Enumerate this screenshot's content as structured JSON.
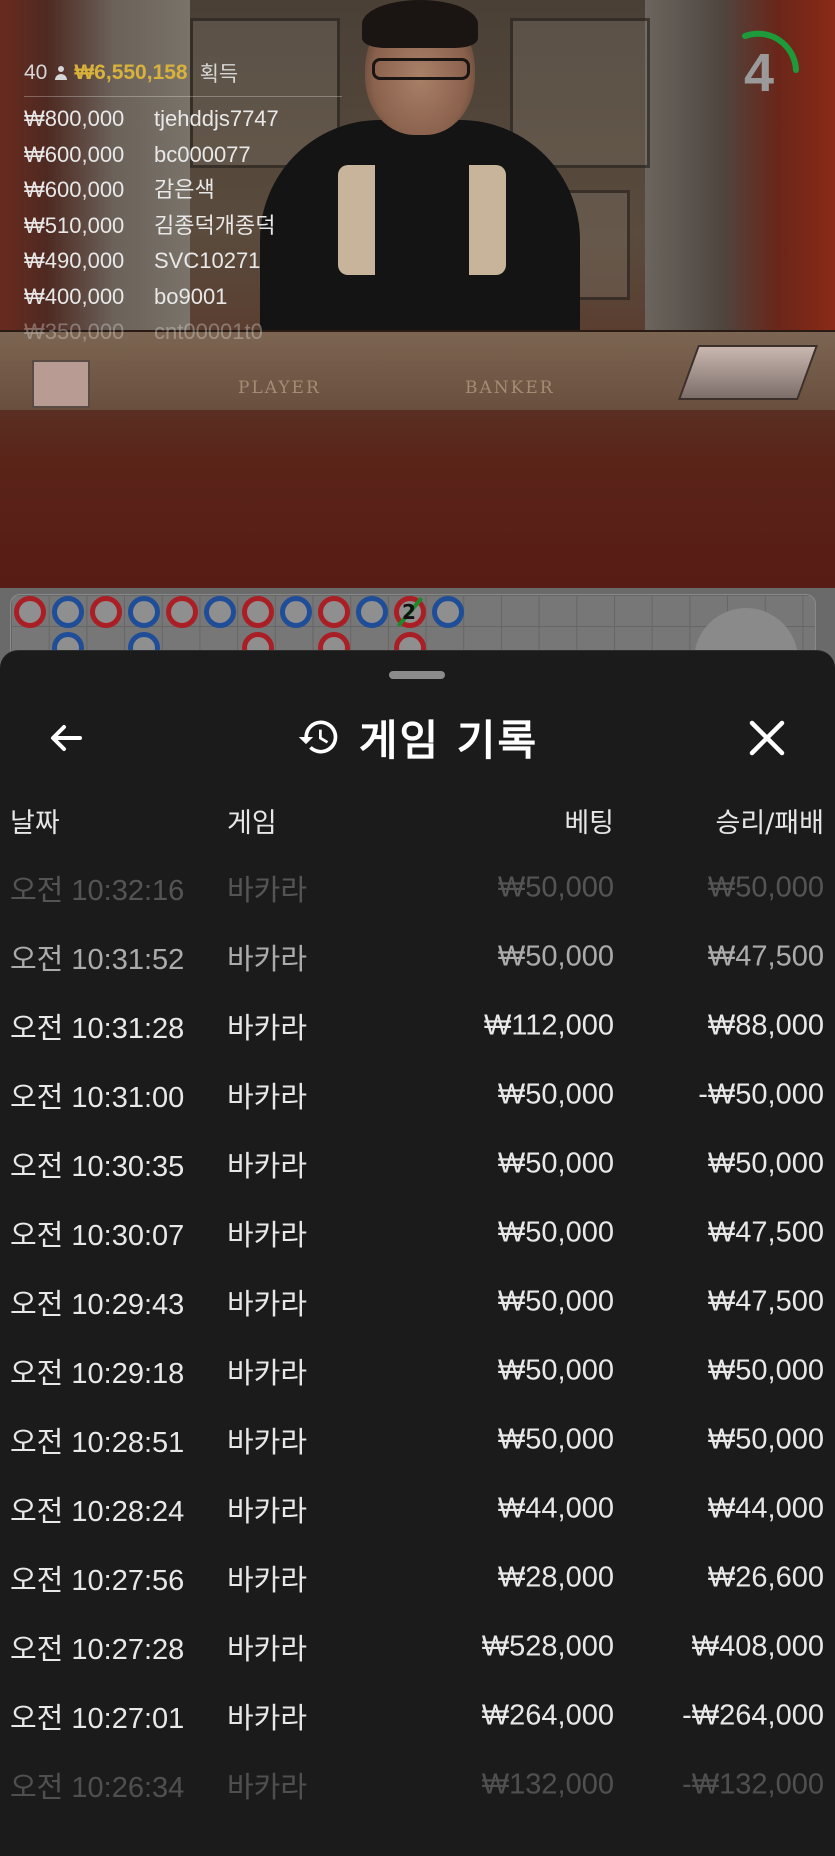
{
  "countdown": "4",
  "winners": {
    "count": "40",
    "total": "₩6,550,158",
    "suffix": "획득",
    "list": [
      {
        "amount": "₩800,000",
        "name": "tjehddjs7747"
      },
      {
        "amount": "₩600,000",
        "name": "bc000077"
      },
      {
        "amount": "₩600,000",
        "name": "감은색"
      },
      {
        "amount": "₩510,000",
        "name": "김종덕개종덕"
      },
      {
        "amount": "₩490,000",
        "name": "SVC10271"
      },
      {
        "amount": "₩400,000",
        "name": "bo9001"
      },
      {
        "amount": "₩350,000",
        "name": "cnt00001t0"
      }
    ]
  },
  "table_labels": {
    "player": "PLAYER",
    "banker": "BANKER"
  },
  "roadmap": {
    "tie_count": "2"
  },
  "sheet": {
    "title": "게임 기록",
    "columns": {
      "date": "날짜",
      "game": "게임",
      "bet": "베팅",
      "win_loss": "승리/패배"
    },
    "rows": [
      {
        "time": "오전 10:32:16",
        "game": "바카라",
        "bet": "₩50,000",
        "result": "₩50,000"
      },
      {
        "time": "오전 10:31:52",
        "game": "바카라",
        "bet": "₩50,000",
        "result": "₩47,500"
      },
      {
        "time": "오전 10:31:28",
        "game": "바카라",
        "bet": "₩112,000",
        "result": "₩88,000"
      },
      {
        "time": "오전 10:31:00",
        "game": "바카라",
        "bet": "₩50,000",
        "result": "-₩50,000"
      },
      {
        "time": "오전 10:30:35",
        "game": "바카라",
        "bet": "₩50,000",
        "result": "₩50,000"
      },
      {
        "time": "오전 10:30:07",
        "game": "바카라",
        "bet": "₩50,000",
        "result": "₩47,500"
      },
      {
        "time": "오전 10:29:43",
        "game": "바카라",
        "bet": "₩50,000",
        "result": "₩47,500"
      },
      {
        "time": "오전 10:29:18",
        "game": "바카라",
        "bet": "₩50,000",
        "result": "₩50,000"
      },
      {
        "time": "오전 10:28:51",
        "game": "바카라",
        "bet": "₩50,000",
        "result": "₩50,000"
      },
      {
        "time": "오전 10:28:24",
        "game": "바카라",
        "bet": "₩44,000",
        "result": "₩44,000"
      },
      {
        "time": "오전 10:27:56",
        "game": "바카라",
        "bet": "₩28,000",
        "result": "₩26,600"
      },
      {
        "time": "오전 10:27:28",
        "game": "바카라",
        "bet": "₩528,000",
        "result": "₩408,000"
      },
      {
        "time": "오전 10:27:01",
        "game": "바카라",
        "bet": "₩264,000",
        "result": "-₩264,000"
      },
      {
        "time": "오전 10:26:34",
        "game": "바카라",
        "bet": "₩132,000",
        "result": "-₩132,000"
      }
    ]
  },
  "colors": {
    "accent_gold": "#d9b23c",
    "timer_green": "#1e9a3a",
    "player_blue": "#1f4d98",
    "banker_red": "#aa1e25"
  },
  "icons": {
    "back": "arrow-left-icon",
    "history": "history-icon",
    "close": "close-icon",
    "user": "user-icon"
  }
}
